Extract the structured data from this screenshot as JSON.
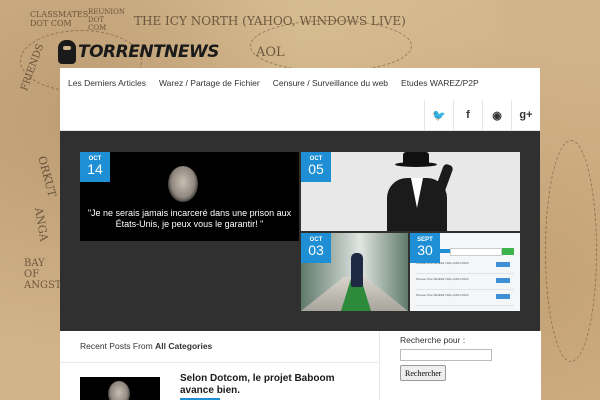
{
  "map": {
    "labels": [
      "CLASSMATES DOT COM",
      "REUNION DOT COM",
      "THE ICY NORTH (YAHOO, WINDOWS LIVE)",
      "FRIENDS",
      "AOL",
      "ORKUT",
      "ANGA",
      "BAY OF ANGST"
    ]
  },
  "logo": {
    "text": "TORRENTNEWS"
  },
  "nav": {
    "items": [
      "Les Derniers Articles",
      "Warez / Partage de Fichier",
      "Censure / Surveillance du web",
      "Etudes WAREZ/P2P"
    ]
  },
  "social": {
    "icons": [
      "twitter-icon",
      "facebook-icon",
      "rss-icon",
      "google-plus-icon"
    ],
    "glyphs": [
      "🐦",
      "f",
      "◉",
      "g+"
    ]
  },
  "slider": {
    "main": {
      "month": "OCT",
      "day": "14",
      "quote": "\"Je ne serais jamais incarceré dans une prison aux États-Unis, je peux vous le garantir! \""
    },
    "hat": {
      "month": "OCT",
      "day": "05"
    },
    "hall": {
      "month": "OCT",
      "day": "03"
    },
    "shot": {
      "month": "SEPT",
      "day": "30",
      "rows": [
        "Pioneer.One.S01E01.720p.x264-VODO",
        "Pioneer.One.S01E02.720p.x264-VODO",
        "Pioneer.One.S01E03.720p.x264-VODO"
      ]
    }
  },
  "posts": {
    "prefix": "Recent Posts From",
    "category": "All Categories",
    "first_title": "Selon Dotcom, le projet Baboom avance bien."
  },
  "search": {
    "label": "Recherche pour :",
    "value": "",
    "button": "Rechercher"
  },
  "colors": {
    "accent": "#1e8fd5",
    "slider_bg": "#303030",
    "map_bg": "#d2b48a"
  }
}
